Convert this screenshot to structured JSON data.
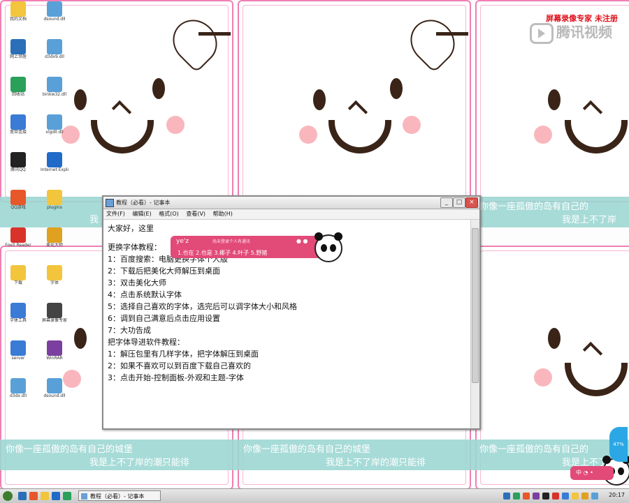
{
  "watermarks": {
    "recorder": "屏幕录像专家 未注册",
    "tencent": "腾讯视频"
  },
  "wallpaper": {
    "band_line1": "你像一座孤傲的岛有自己的城堡",
    "band_line2": "我是上不了岸的潮只能徘",
    "band_line1_short": "你像一座孤傲的岛有自己的",
    "band_line2_short": "我是上不了岸"
  },
  "notepad": {
    "title": "教程（必看）- 记事本",
    "menu": [
      "文件(F)",
      "编辑(E)",
      "格式(O)",
      "查看(V)",
      "帮助(H)"
    ],
    "lines": [
      "大家好，这里",
      "更换字体教程：",
      "",
      "1：百度搜索：电脑更换字体个人版",
      "2：下载后把美化大师解压到桌面",
      "3：双击美化大师",
      "4：点击系统默认字体",
      "5：选择自己喜欢的字体，选完后可以调字体大小和风格",
      "6：调到自己满意后点击应用设置",
      "7：大功告成",
      "",
      "把字体导进软件教程：",
      "",
      "1：解压包里有几样字体，把字体解压到桌面",
      "2：如果不喜欢可以到百度下载自己喜欢的",
      "3：点击开始-控制面板-外观和主题-字体"
    ],
    "buttons": {
      "minimize": "_",
      "maximize": "□",
      "close": "×"
    }
  },
  "ime": {
    "input": "ye'z",
    "hint": "尚未登录个人有通讯",
    "candidates": "1.也在  2.也是  3.椰子  4.叶子  5.野猪"
  },
  "ime_mini": {
    "label": "中 ◔ •"
  },
  "bubble": {
    "label": "47%"
  },
  "taskbar": {
    "task_label": "教程（必看）- 记事本",
    "clock": "20:17"
  },
  "desktop_icons": [
    {
      "label": "我的文档",
      "color": "#f2c53d"
    },
    {
      "label": "dsound.dll",
      "color": "#5aa0d8"
    },
    {
      "label": "网上邻居",
      "color": "#2b6fb8"
    },
    {
      "label": "d3dx9.dll",
      "color": "#5aa0d8"
    },
    {
      "label": "回收站",
      "color": "#2aa05a"
    },
    {
      "label": "binkw32.dll",
      "color": "#5aa0d8"
    },
    {
      "label": "宽带连接",
      "color": "#3a7bd5"
    },
    {
      "label": "xlgdll.dll",
      "color": "#5aa0d8"
    },
    {
      "label": "腾讯QQ",
      "color": "#222222"
    },
    {
      "label": "Internet Explorer",
      "color": "#1f6bc7"
    },
    {
      "label": "QQ游戏",
      "color": "#e8572a"
    },
    {
      "label": "plugins",
      "color": "#f2c53d"
    },
    {
      "label": "Foxit Reader",
      "color": "#d8322a"
    },
    {
      "label": "美化大师",
      "color": "#e0a020"
    },
    {
      "label": "下载",
      "color": "#f2c53d"
    },
    {
      "label": "字体",
      "color": "#f2c53d"
    },
    {
      "label": "字体工具",
      "color": "#3a7bd5"
    },
    {
      "label": "屏幕录像专家",
      "color": "#444444"
    },
    {
      "label": "server",
      "color": "#3a7bd5"
    },
    {
      "label": "WinRAR",
      "color": "#7b3fa0"
    },
    {
      "label": "d3dx.dll",
      "color": "#5aa0d8"
    },
    {
      "label": "dsound.dll",
      "color": "#5aa0d8"
    }
  ]
}
